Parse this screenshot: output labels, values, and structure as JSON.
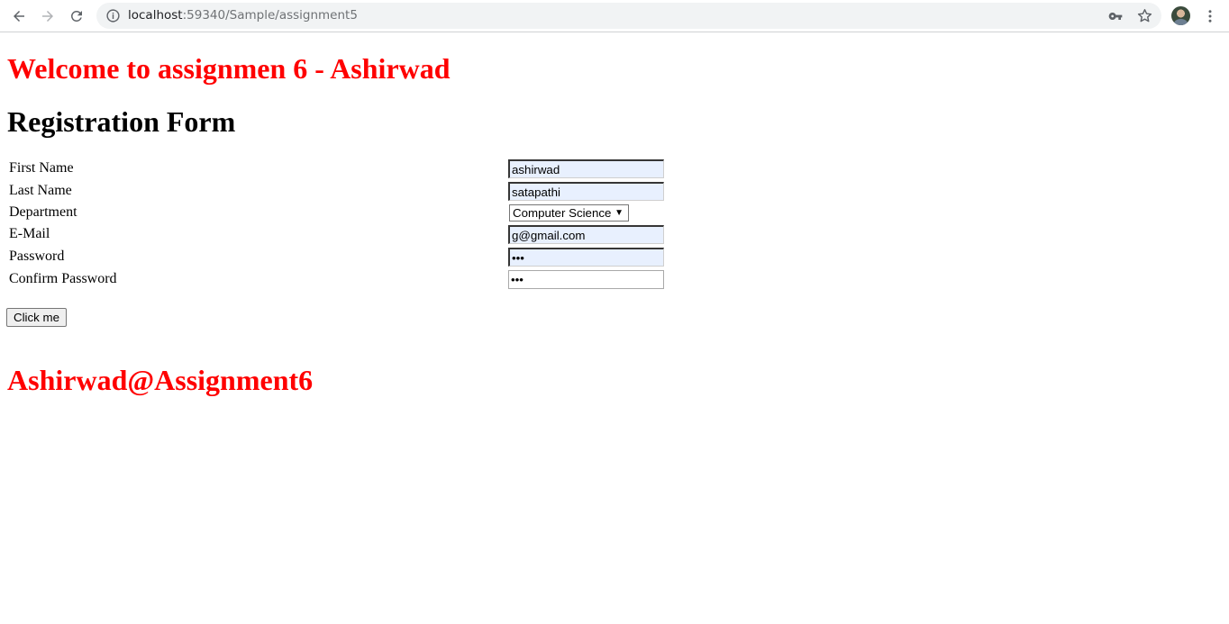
{
  "browser": {
    "url_host": "localhost",
    "url_path": ":59340/Sample/assignment5"
  },
  "page": {
    "welcome_heading": "Welcome to assignmen 6 - Ashirwad",
    "form_title": "Registration Form",
    "fields": {
      "first_name": {
        "label": "First Name",
        "value": "ashirwad"
      },
      "last_name": {
        "label": "Last Name",
        "value": "satapathi"
      },
      "department": {
        "label": "Department",
        "value": "Computer Science"
      },
      "email": {
        "label": "E-Mail",
        "value": "g@gmail.com"
      },
      "password": {
        "label": "Password",
        "value": "•••"
      },
      "confirm_password": {
        "label": "Confirm Password",
        "value": "•••"
      }
    },
    "submit_label": "Click me",
    "footer_heading": "Ashirwad@Assignment6"
  },
  "colors": {
    "heading_accent": "#ff0000",
    "autofill_background": "#e8f0fe"
  },
  "icons": [
    "back-icon",
    "forward-icon",
    "reload-icon",
    "info-icon",
    "key-icon",
    "star-icon",
    "avatar",
    "menu-icon"
  ]
}
